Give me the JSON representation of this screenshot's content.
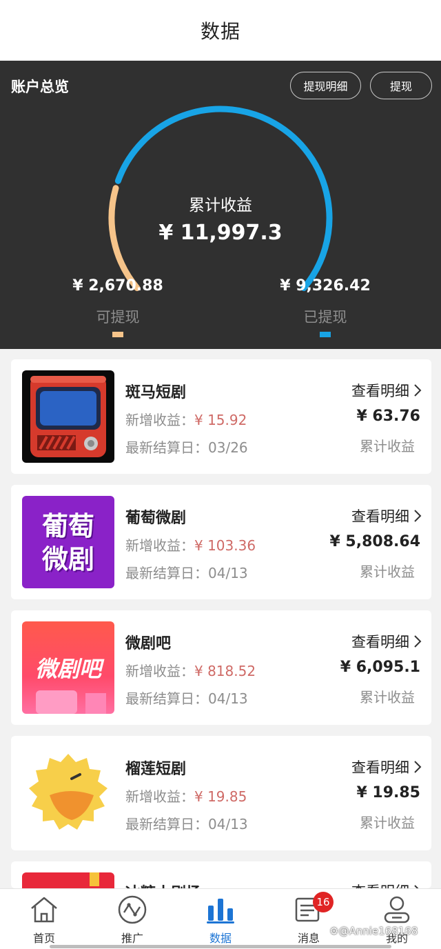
{
  "header": {
    "title": "数据"
  },
  "summary": {
    "title": "账户总览",
    "detail_button": "提现明细",
    "withdraw_button": "提现",
    "total_label": "累计收益",
    "total_value": "¥ 11,997.3",
    "available_value": "¥ 2,670.88",
    "available_label": "可提现",
    "withdrawn_value": "¥ 9,326.42",
    "withdrawn_label": "已提现",
    "available_fraction": 0.2226,
    "colors": {
      "available": "#f6c48a",
      "withdrawn": "#18a4e6"
    }
  },
  "cards": [
    {
      "name": "斑马短剧",
      "new_label": "新增收益：",
      "new_amount": "¥ 15.92",
      "date_label": "最新结算日：",
      "date": "03/26",
      "detail_link": "查看明细",
      "total_value": "¥ 63.76",
      "total_label": "累计收益",
      "icon": "retro-tv-icon"
    },
    {
      "name": "葡萄微剧",
      "new_label": "新增收益：",
      "new_amount": "¥ 103.36",
      "date_label": "最新结算日：",
      "date": "04/13",
      "detail_link": "查看明细",
      "total_value": "¥ 5,808.64",
      "total_label": "累计收益",
      "icon": "grape-drama-logo",
      "logo_line1": "葡萄",
      "logo_line2": "微剧"
    },
    {
      "name": "微剧吧",
      "new_label": "新增收益：",
      "new_amount": "¥ 818.52",
      "date_label": "最新结算日：",
      "date": "04/13",
      "detail_link": "查看明细",
      "total_value": "¥ 6,095.1",
      "total_label": "累计收益",
      "icon": "weijuba-logo",
      "logo_text": "微剧吧"
    },
    {
      "name": "榴莲短剧",
      "new_label": "新增收益：",
      "new_amount": "¥ 19.85",
      "date_label": "最新结算日：",
      "date": "04/13",
      "detail_link": "查看明细",
      "total_value": "¥ 19.85",
      "total_label": "累计收益",
      "icon": "durian-chick-icon"
    },
    {
      "name": "冰糖小剧场",
      "detail_link": "查看明细"
    }
  ],
  "tabbar": {
    "tabs": [
      {
        "label": "首页",
        "icon": "home-icon"
      },
      {
        "label": "推广",
        "icon": "promote-icon"
      },
      {
        "label": "数据",
        "icon": "bar-chart-icon",
        "active": true
      },
      {
        "label": "消息",
        "icon": "message-icon",
        "badge": "16"
      },
      {
        "label": "我的",
        "icon": "profile-icon"
      }
    ],
    "active_color": "#1c74d4"
  },
  "watermark": "⚙@Annie168168"
}
